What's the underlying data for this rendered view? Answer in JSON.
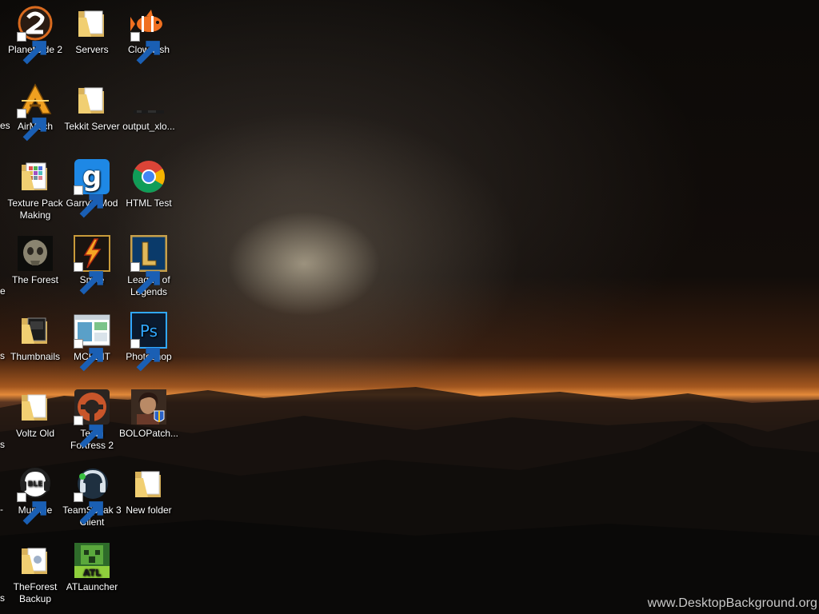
{
  "desktop": {
    "watermark": "www.DesktopBackground.org",
    "left_edge_fragments": [
      "es",
      "e",
      "s",
      "s",
      "-",
      "s"
    ],
    "columns": [
      {
        "icons": [
          {
            "label": "PlanetSide 2",
            "icon": "planetside-2-icon",
            "shortcut": true
          },
          {
            "label": "AirMech",
            "icon": "airmech-icon",
            "shortcut": true
          },
          {
            "label": "Texture Pack Making",
            "icon": "folder-icon",
            "shortcut": false
          },
          {
            "label": "The Forest",
            "icon": "the-forest-icon",
            "shortcut": false
          },
          {
            "label": "Thumbnails",
            "icon": "folder-icon",
            "shortcut": false
          },
          {
            "label": "Voltz Old",
            "icon": "folder-icon",
            "shortcut": false
          },
          {
            "label": "Mumble",
            "icon": "mumble-icon",
            "shortcut": true
          },
          {
            "label": "TheForest Backup",
            "icon": "folder-icon",
            "shortcut": false
          }
        ]
      },
      {
        "icons": [
          {
            "label": "Servers",
            "icon": "folder-icon",
            "shortcut": false
          },
          {
            "label": "Tekkit Server",
            "icon": "folder-icon",
            "shortcut": false
          },
          {
            "label": "Garry's Mod",
            "icon": "garrys-mod-icon",
            "shortcut": true
          },
          {
            "label": "Smite",
            "icon": "smite-icon",
            "shortcut": true
          },
          {
            "label": "MCEDIT",
            "icon": "mcedit-icon",
            "shortcut": true
          },
          {
            "label": "Team Fortress 2",
            "icon": "team-fortress-2-icon",
            "shortcut": true
          },
          {
            "label": "TeamSpeak 3 Client",
            "icon": "teamspeak-icon",
            "shortcut": true
          },
          {
            "label": "ATLauncher",
            "icon": "atlauncher-icon",
            "shortcut": false
          }
        ]
      },
      {
        "icons": [
          {
            "label": "Clownfish",
            "icon": "clownfish-icon",
            "shortcut": true
          },
          {
            "label": "output_xlo...",
            "icon": "file-icon",
            "shortcut": false
          },
          {
            "label": "HTML Test",
            "icon": "chrome-icon",
            "shortcut": false
          },
          {
            "label": "League of Legends",
            "icon": "league-of-legends-icon",
            "shortcut": true
          },
          {
            "label": "Photoshop",
            "icon": "photoshop-icon",
            "shortcut": true
          },
          {
            "label": "BOLOPatch...",
            "icon": "bolopatch-icon",
            "shortcut": false
          },
          {
            "label": "New folder",
            "icon": "folder-icon",
            "shortcut": false
          }
        ]
      }
    ]
  },
  "colors": {
    "horizon_glow": "#e48a3a",
    "sky": "#0c0a08",
    "text": "#ffffff"
  }
}
